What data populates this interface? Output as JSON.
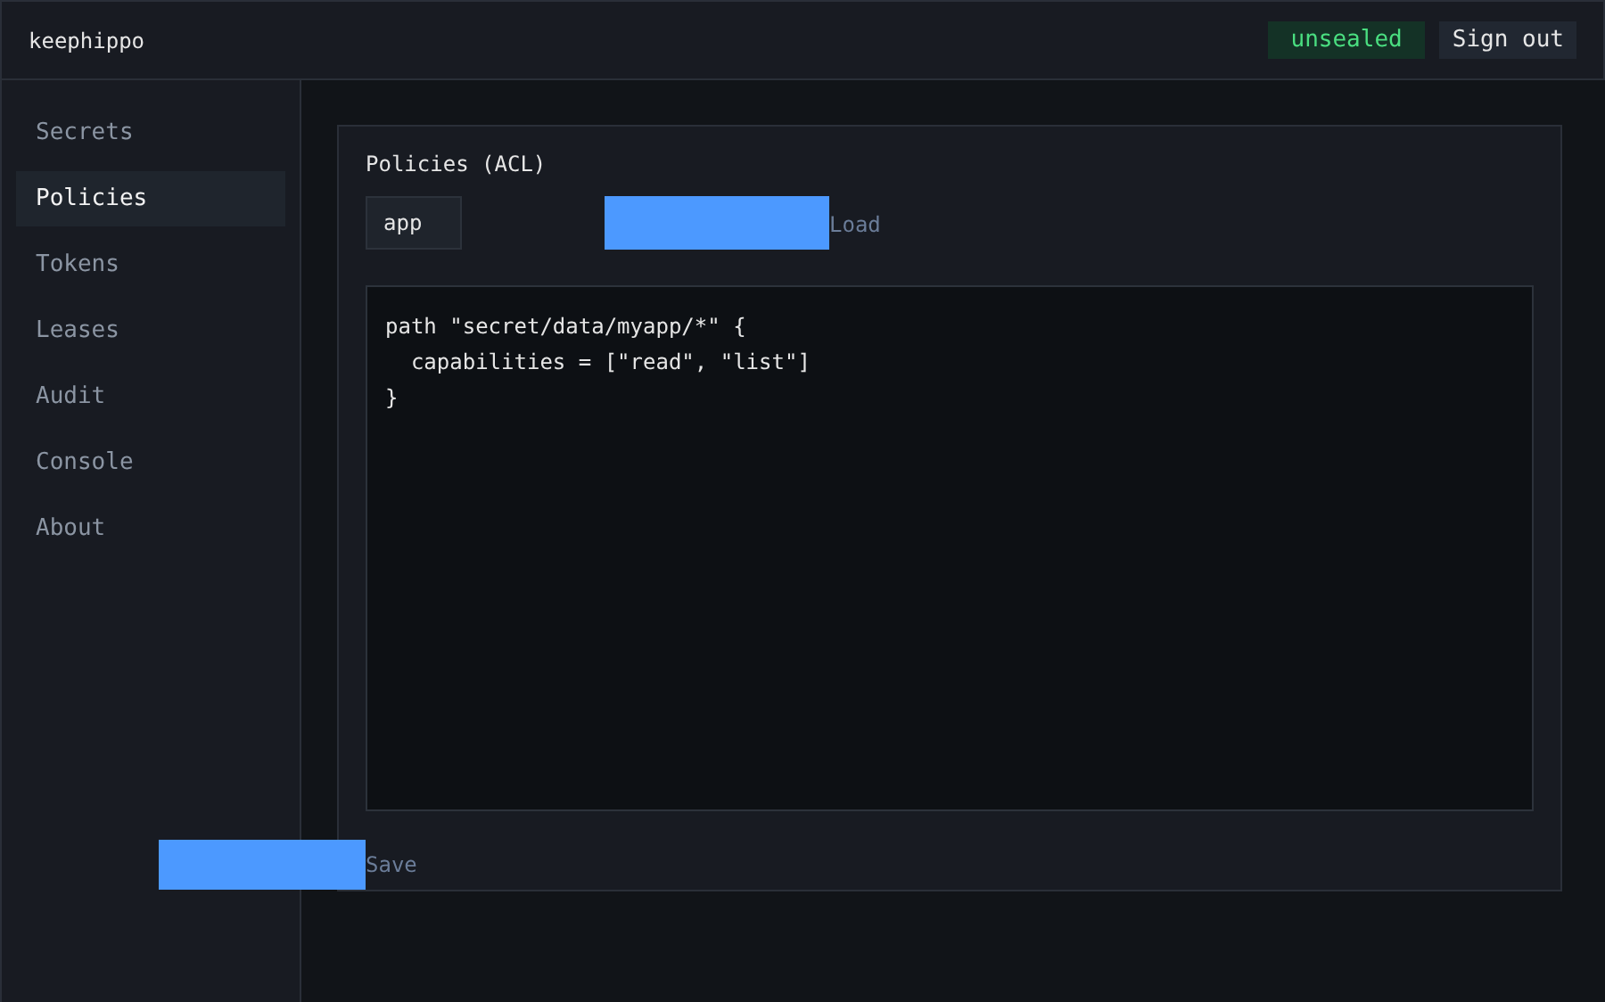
{
  "header": {
    "title": "keephippo",
    "status": "unsealed",
    "sign_out": "Sign out"
  },
  "sidebar": {
    "items": [
      {
        "label": "Secrets",
        "selected": false
      },
      {
        "label": "Policies",
        "selected": true
      },
      {
        "label": "Tokens",
        "selected": false
      },
      {
        "label": "Leases",
        "selected": false
      },
      {
        "label": "Audit",
        "selected": false
      },
      {
        "label": "Console",
        "selected": false
      },
      {
        "label": "About",
        "selected": false
      }
    ]
  },
  "panel": {
    "title": "Policies (ACL)",
    "policy_name": "app",
    "load_button": "Load",
    "editor_lines": [
      "path \"secret/data/myapp/*\" {",
      "  capabilities = [\"read\", \"list\"]",
      "}"
    ],
    "save_button": "Save"
  }
}
